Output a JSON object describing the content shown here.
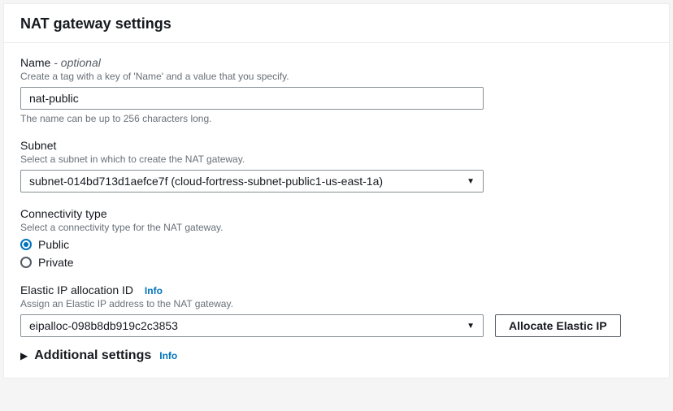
{
  "panel_title": "NAT gateway settings",
  "name": {
    "label": "Name",
    "optional_suffix": " - optional",
    "description": "Create a tag with a key of 'Name' and a value that you specify.",
    "value": "nat-public",
    "constraint": "The name can be up to 256 characters long."
  },
  "subnet": {
    "label": "Subnet",
    "description": "Select a subnet in which to create the NAT gateway.",
    "selected": "subnet-014bd713d1aefce7f (cloud-fortress-subnet-public1-us-east-1a)"
  },
  "connectivity": {
    "label": "Connectivity type",
    "description": "Select a connectivity type for the NAT gateway.",
    "options": [
      "Public",
      "Private"
    ],
    "selected": "Public"
  },
  "elastic_ip": {
    "label": "Elastic IP allocation ID",
    "info": "Info",
    "description": "Assign an Elastic IP address to the NAT gateway.",
    "selected": "eipalloc-098b8db919c2c3853",
    "allocate_button": "Allocate Elastic IP"
  },
  "additional_settings": {
    "label": "Additional settings",
    "info": "Info"
  }
}
